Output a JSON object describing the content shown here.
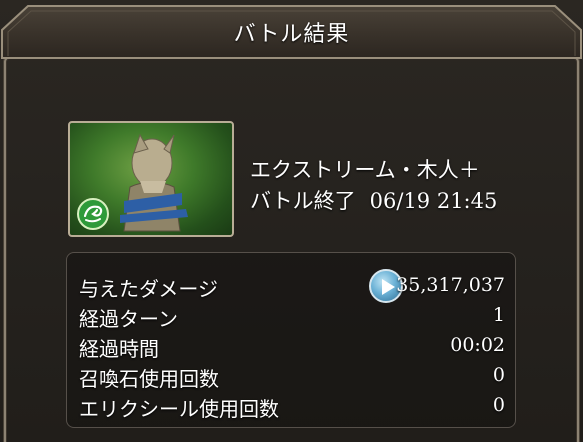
{
  "window": {
    "title": "バトル結果"
  },
  "quest": {
    "name": "エクストリーム・木人＋",
    "status": "バトル終了",
    "datetime": "06/19 21:45",
    "element_icon": "wind-element-icon"
  },
  "stats": [
    {
      "label": "与えたダメージ",
      "value": "35,317,037"
    },
    {
      "label": "経過ターン",
      "value": "1"
    },
    {
      "label": "経過時間",
      "value": "00:02"
    },
    {
      "label": "召喚石使用回数",
      "value": "0"
    },
    {
      "label": "エリクシール使用回数",
      "value": "0"
    }
  ],
  "colors": {
    "background": "#25221e",
    "frame": "#8d8373",
    "text": "#ffffff",
    "element_green": "#3f7a2a",
    "play_button": "#6cb2d6"
  }
}
